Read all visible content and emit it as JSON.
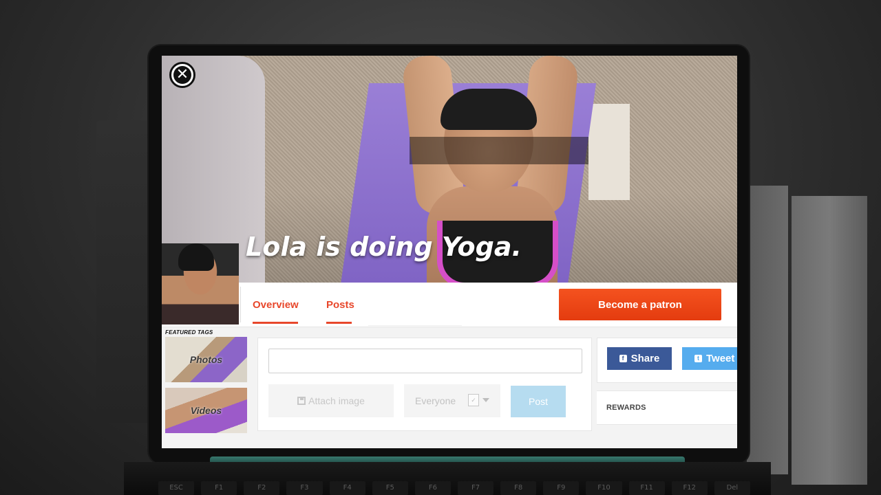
{
  "hero": {
    "title": "Lola is doing Yoga."
  },
  "close_button": {
    "symbol": "✕"
  },
  "nav": {
    "tabs": [
      {
        "label": "Overview"
      },
      {
        "label": "Posts"
      }
    ],
    "patron_button": "Become a patron"
  },
  "featured": {
    "label": "FEATURED TAGS",
    "tags": [
      {
        "label": "Photos"
      },
      {
        "label": "Videos"
      }
    ]
  },
  "composer": {
    "input_value": "",
    "attach_label": "Attach image",
    "audience_value": "Everyone",
    "post_label": "Post"
  },
  "share": {
    "share_label": "Share",
    "tweet_label": "Tweet",
    "share_icon": "f",
    "tweet_icon": "t"
  },
  "rewards": {
    "label": "REWARDS"
  },
  "keyboard": {
    "keys": [
      "ESC",
      "F1",
      "F2",
      "F3",
      "F4",
      "F5",
      "F6",
      "F7",
      "F8",
      "F9",
      "F10",
      "F11",
      "F12",
      "Del"
    ]
  },
  "colors": {
    "accent": "#e8472b",
    "patron_button": "#f4521f",
    "facebook": "#3b5998",
    "twitter": "#55acee",
    "post_button": "#b6dcf0"
  },
  "icons": {
    "close": "close-icon",
    "attach": "floppy-icon",
    "share": "facebook-icon",
    "tweet": "twitter-icon",
    "select_caret": "chevron-down-icon"
  }
}
